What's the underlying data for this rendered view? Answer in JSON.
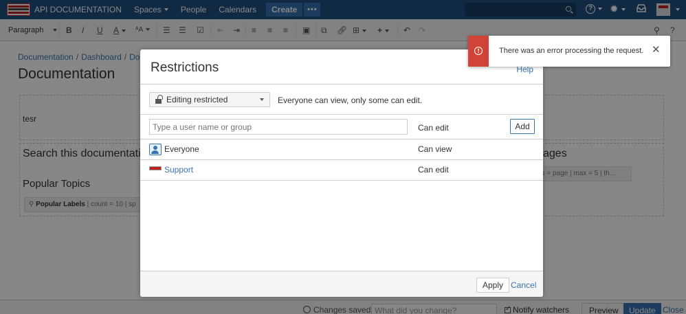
{
  "nav": {
    "space_title": "API DOCUMENTATION",
    "spaces": "Spaces",
    "people": "People",
    "calendars": "Calendars",
    "create": "Create",
    "more": "•••",
    "help_icon": "?"
  },
  "toolbar": {
    "paragraph": "Paragraph",
    "bold": "B",
    "italic": "I",
    "underline": "U",
    "text_color": "A",
    "more_format": "ᴬA"
  },
  "breadcrumb": [
    "Documentation",
    "Dashboard",
    "Docume"
  ],
  "page": {
    "title": "Documentation",
    "body_text": "tesr",
    "search_heading": "Search this documentation",
    "popular_heading": "Popular Topics",
    "popular_macro_name": "Popular Labels",
    "popular_macro_params": "| count = 10 | sp",
    "right_heading": "ages",
    "right_macro_params": "es = page | max = 5 | th..."
  },
  "bottom": {
    "changes_saved": "Changes saved",
    "what_changed_placeholder": "What did you change?",
    "notify_watchers": "Notify watchers",
    "preview": "Preview",
    "update": "Update",
    "close": "Close"
  },
  "dialog": {
    "title": "Restrictions",
    "help": "Help",
    "restriction_select": "Editing restricted",
    "restriction_description": "Everyone can view, only some can edit.",
    "user_placeholder": "Type a user name or group",
    "add_permission": "Can edit",
    "add": "Add",
    "entries": [
      {
        "name": "Everyone",
        "permission": "Can view",
        "icon": "group-icon",
        "is_link": false
      },
      {
        "name": "Support",
        "permission": "Can edit",
        "icon": "support-avatar-icon",
        "is_link": true
      }
    ],
    "apply": "Apply",
    "cancel": "Cancel"
  },
  "error_flag": {
    "message": "There was an error processing the request.",
    "color": "#d04437"
  },
  "colors": {
    "header": "#205081",
    "link": "#3b73af",
    "primary_button": "#3572b0"
  }
}
